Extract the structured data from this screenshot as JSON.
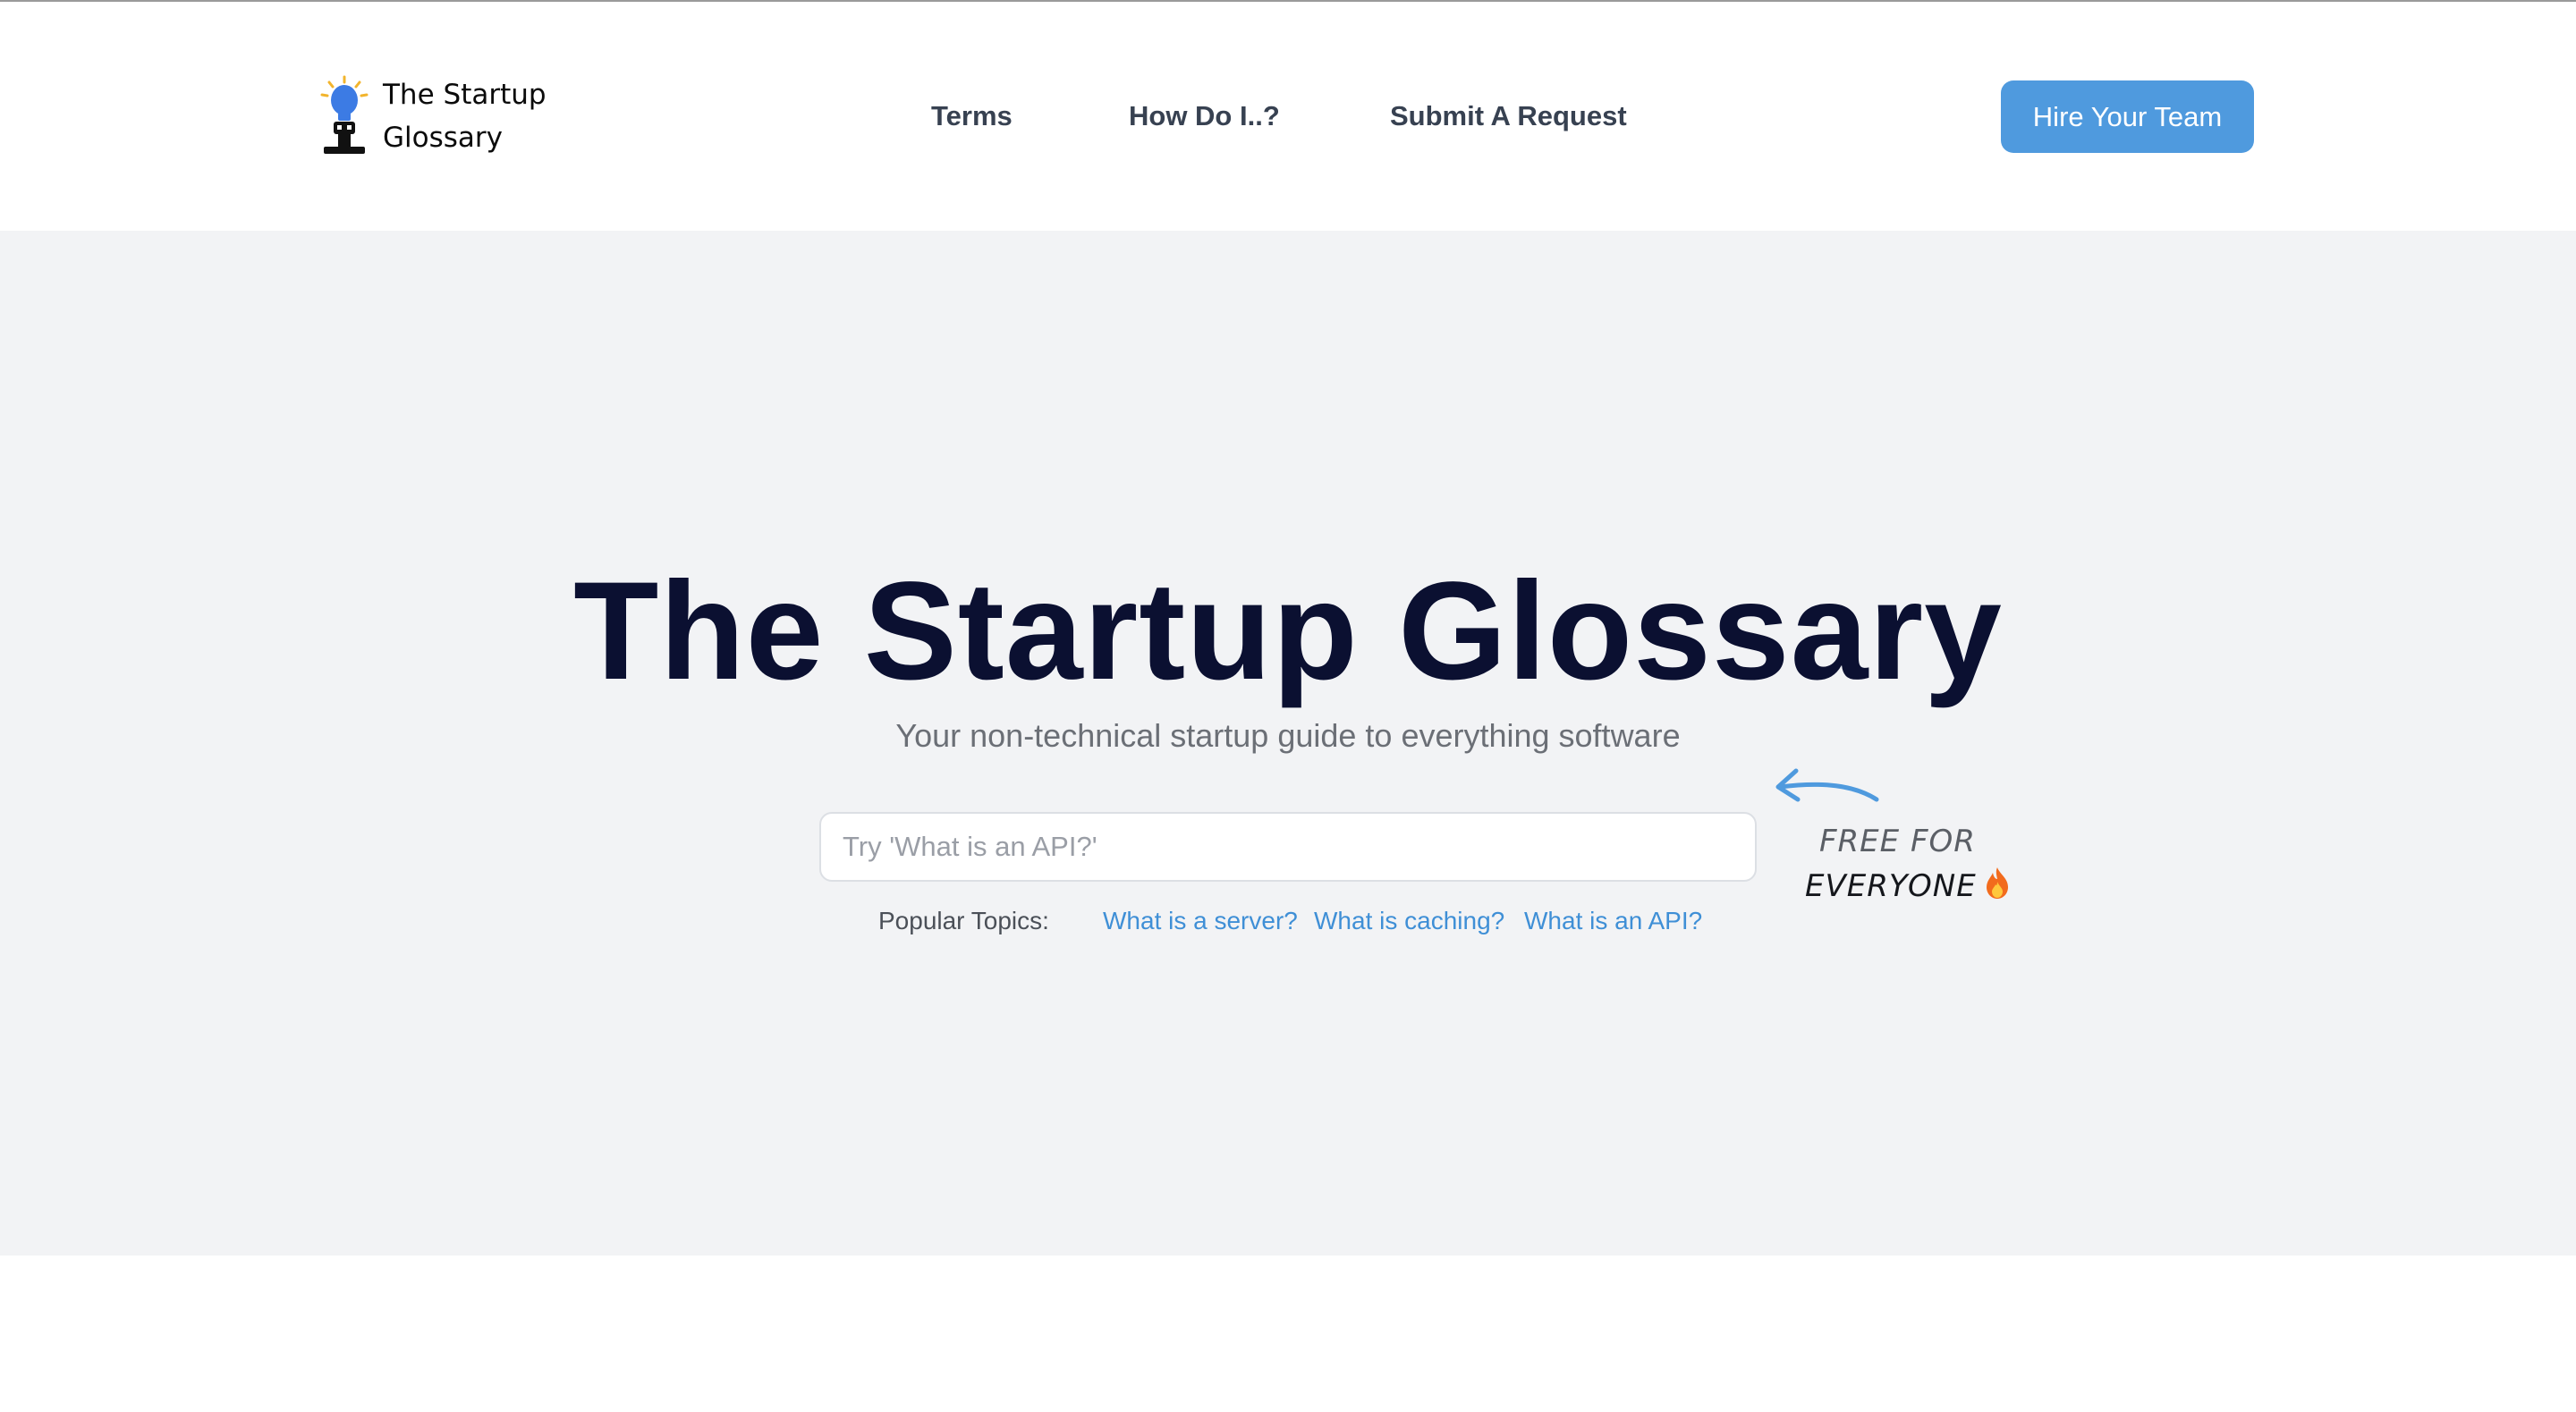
{
  "header": {
    "logo": {
      "line1": "The Startup",
      "line2": "Glossary",
      "icon": "lightbulb-person-icon"
    },
    "nav": [
      {
        "label": "Terms"
      },
      {
        "label": "How Do I..?"
      },
      {
        "label": "Submit A Request"
      }
    ],
    "cta": {
      "label": "Hire Your Team"
    }
  },
  "hero": {
    "title": "The Startup Glossary",
    "subtitle": "Your non-technical startup guide to everything software",
    "search": {
      "placeholder": "Try 'What is an API?'",
      "value": ""
    },
    "popular": {
      "label": "Popular Topics:",
      "topics": [
        {
          "label": "What is a server?"
        },
        {
          "label": "What is caching?"
        },
        {
          "label": "What is an API?"
        }
      ]
    },
    "badge": {
      "line1": "FREE FOR",
      "line2": "EVERYONE",
      "icons": [
        "curved-arrow-icon",
        "fire-icon"
      ]
    }
  },
  "colors": {
    "brand_blue": "#4f9ade",
    "link_blue": "#3f8fd6",
    "title_navy": "#0b1031",
    "hero_bg": "#f2f3f5",
    "nav_text": "#374151"
  }
}
